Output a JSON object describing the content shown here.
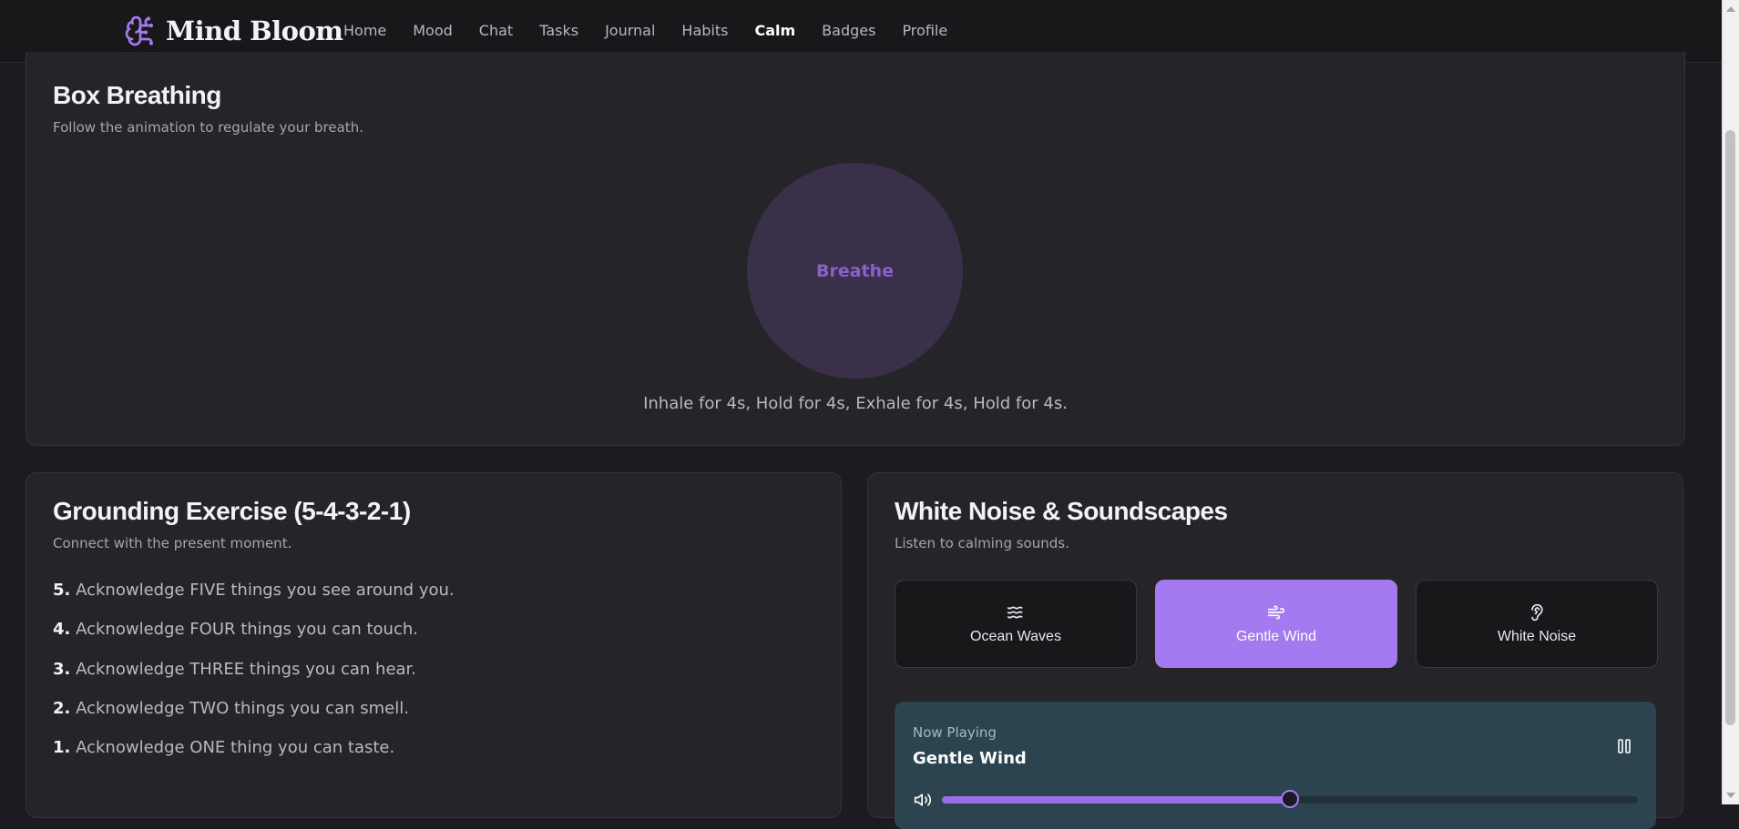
{
  "app": {
    "name": "Mind Bloom"
  },
  "nav": {
    "items": [
      "Home",
      "Mood",
      "Chat",
      "Tasks",
      "Journal",
      "Habits",
      "Calm",
      "Badges",
      "Profile"
    ],
    "active": "Calm"
  },
  "box_breathing": {
    "title": "Box Breathing",
    "subtitle": "Follow the animation to regulate your breath.",
    "circle_label": "Breathe",
    "instructions": "Inhale for 4s, Hold for 4s, Exhale for 4s, Hold for 4s."
  },
  "grounding": {
    "title": "Grounding Exercise (5-4-3-2-1)",
    "subtitle": "Connect with the present moment.",
    "steps": [
      {
        "num": "5.",
        "text": "Acknowledge FIVE things you see around you."
      },
      {
        "num": "4.",
        "text": "Acknowledge FOUR things you can touch."
      },
      {
        "num": "3.",
        "text": "Acknowledge THREE things you can hear."
      },
      {
        "num": "2.",
        "text": "Acknowledge TWO things you can smell."
      },
      {
        "num": "1.",
        "text": "Acknowledge ONE thing you can taste."
      }
    ]
  },
  "white_noise": {
    "title": "White Noise & Soundscapes",
    "subtitle": "Listen to calming sounds.",
    "sounds": [
      {
        "label": "Ocean Waves",
        "icon": "waves-icon"
      },
      {
        "label": "Gentle Wind",
        "icon": "wind-icon"
      },
      {
        "label": "White Noise",
        "icon": "ear-icon"
      }
    ],
    "selected": "Gentle Wind",
    "player": {
      "now_playing_label": "Now Playing",
      "track": "Gentle Wind",
      "volume": 0.5
    }
  },
  "colors": {
    "accent": "#a57af0",
    "background": "#1c1b20",
    "card": "#252429",
    "player": "#2c4450"
  }
}
